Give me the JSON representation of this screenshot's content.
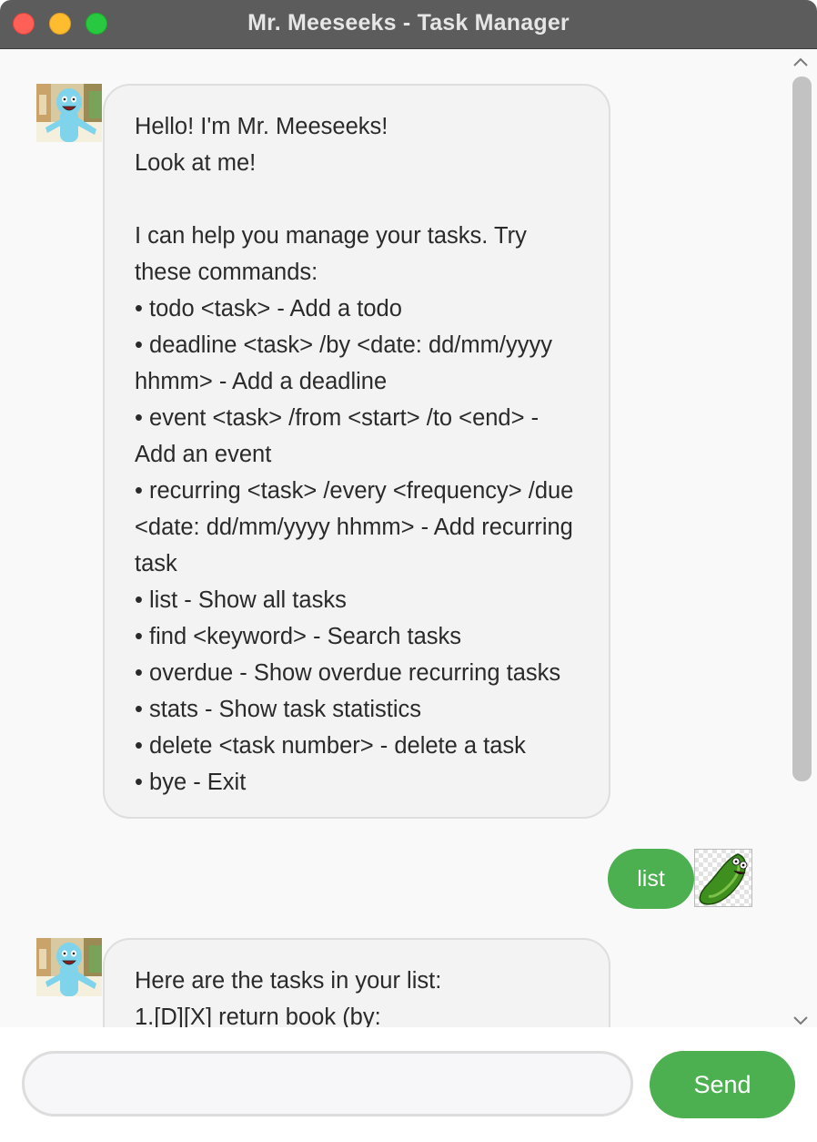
{
  "window": {
    "title": "Mr. Meeseeks - Task Manager"
  },
  "chat": {
    "messages": [
      {
        "sender": "bot",
        "avatar": "meeseeks-avatar",
        "text": "Hello! I'm Mr. Meeseeks!\nLook at me!\n\nI can help you manage your tasks. Try these commands:\n• todo <task> - Add a todo\n• deadline <task> /by <date: dd/mm/yyyy hhmm> - Add a deadline\n• event <task> /from <start> /to <end> - Add an event\n• recurring <task> /every <frequency> /due <date: dd/mm/yyyy hhmm> - Add recurring task\n• list - Show all tasks\n• find <keyword> - Search tasks\n• overdue - Show overdue recurring tasks\n• stats - Show task statistics\n• delete <task number> - delete a task\n• bye - Exit"
      },
      {
        "sender": "user",
        "avatar": "pickle-rick-avatar",
        "text": "list"
      },
      {
        "sender": "bot",
        "avatar": "meeseeks-avatar",
        "text": "Here are the tasks in your list:\n1.[D][X] return book (by:"
      }
    ]
  },
  "input": {
    "value": "",
    "placeholder": ""
  },
  "send_button": {
    "label": "Send"
  },
  "colors": {
    "titlebar": "#5c5c5c",
    "bot_bubble": "#f3f3f3",
    "user_bubble": "#4caf50",
    "send_button": "#4caf50",
    "close": "#fe5f57",
    "minimize": "#febc2e",
    "maximize": "#28c840"
  },
  "icons": [
    "close-icon",
    "minimize-icon",
    "maximize-icon",
    "scroll-up-icon",
    "scroll-down-icon"
  ]
}
